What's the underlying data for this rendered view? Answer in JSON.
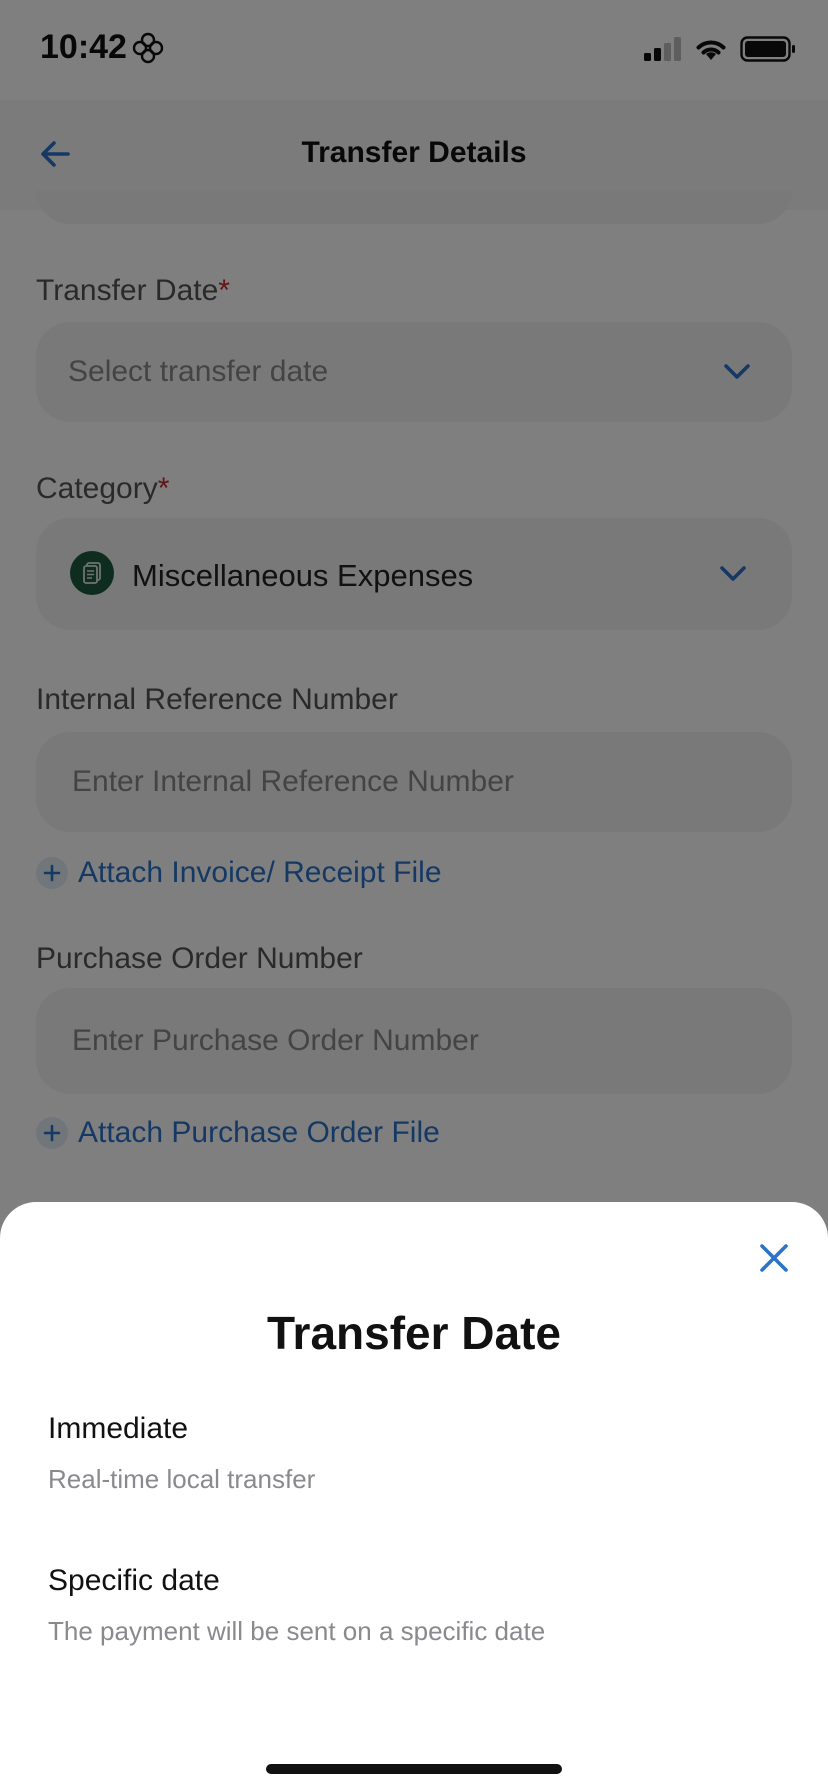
{
  "status_bar": {
    "time": "10:42"
  },
  "nav": {
    "title": "Transfer Details"
  },
  "form": {
    "transfer_date": {
      "label": "Transfer Date",
      "required_mark": "*",
      "placeholder": "Select transfer date"
    },
    "category": {
      "label": "Category",
      "required_mark": "*",
      "value": "Miscellaneous Expenses"
    },
    "internal_reference": {
      "label": "Internal Reference Number",
      "placeholder": "Enter Internal Reference Number"
    },
    "attach_invoice": {
      "label": "Attach Invoice/ Receipt File"
    },
    "purchase_order": {
      "label": "Purchase Order Number",
      "placeholder": "Enter Purchase Order Number"
    },
    "attach_po": {
      "label": "Attach Purchase Order File"
    }
  },
  "sheet": {
    "title": "Transfer Date",
    "options": [
      {
        "title": "Immediate",
        "description": "Real-time local transfer"
      },
      {
        "title": "Specific date",
        "description": "The payment will be sent on a specific date"
      }
    ]
  },
  "icons": {
    "back": "arrow-left-icon",
    "chevron": "chevron-down-icon",
    "category": "document-icon",
    "plus": "plus-icon",
    "close": "close-icon"
  },
  "colors": {
    "accent": "#2a73c8",
    "required": "#c62828",
    "category_icon_bg": "#1f5a3c"
  }
}
